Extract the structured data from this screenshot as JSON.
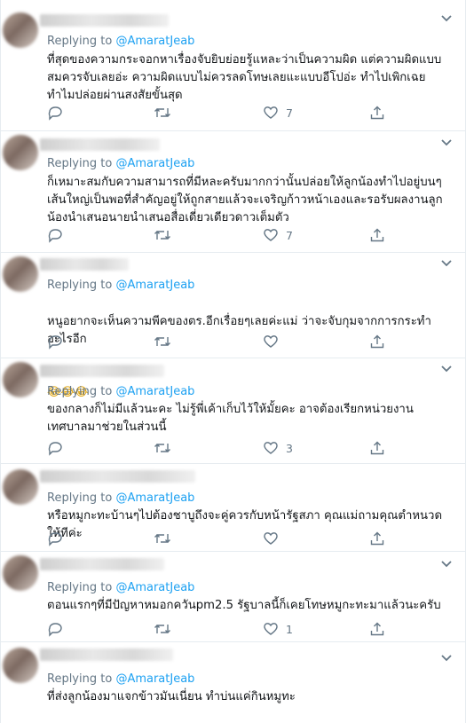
{
  "replying_prefix": "Replying to",
  "colors": {
    "accent": "#1da1f2",
    "muted": "#657786",
    "text": "#14171a",
    "border": "#e6ecf0"
  },
  "icons": {
    "reply": "reply-icon",
    "retweet": "retweet-icon",
    "like": "heart-icon",
    "share": "share-icon",
    "menu": "chevron-down-icon"
  },
  "tweets": [
    {
      "replying_to": "@AmaratJeab",
      "text": "ที่สุดของความกระจอกหาเรื่องจับยิบย่อยรู้แหละว่าเป็นความผิด แต่ความผิดแบบสมควรจับเลยอ่ะ ความผิดแบบไม่ควรลดโทษเลยแะแบบอีโปอ่ะ ทำไปเพิกเฉย ทำไมปล่อยผ่านสงสัยขั้นสุด",
      "replies": "",
      "retweets": "",
      "likes": "7"
    },
    {
      "replying_to": "@AmaratJeab",
      "text": "ก็เหมาะสมกับความสามารถที่มีหละครับมากกว่านั้นปล่อยให้ลูกน้องทำไปอยู่บนๆเส้นใหญ่เป็นพอที่สำคัญอยู่ให้ถูกสายแล้วจะเจริญก้าวหน้าเองและรอรับผลงานลูกน้องนำเสนอนายนำเสนอสื่อเดี่ยวเดียวดาวเต็มตัว",
      "replies": "",
      "retweets": "",
      "likes": "7"
    },
    {
      "replying_to": "@AmaratJeab",
      "text": "หนูอยากจะเห็นความพีคของตร.อีกเรื่อยๆเลยค่ะแม่ ว่าจะจับกุมจากการกระทำอะไรอีก",
      "emoji": "😂😂😂",
      "replies": "",
      "retweets": "",
      "likes": ""
    },
    {
      "replying_to": "@AmaratJeab",
      "text": "ของกลางก็ไม่มีแล้วนะคะ ไม่รู้พี่เค้าเก็บไว้ให้มั้ยคะ อาจต้องเรียกหน่วยงานเทศบาลมาช่วยในส่วนนี้",
      "replies": "",
      "retweets": "",
      "likes": "3"
    },
    {
      "replying_to": "@AmaratJeab",
      "text": "หรือหมูกะทะบ้านๆไปต้องชาบูถึงจะคู่ควรกับหน้ารัฐสภา คุณแม่ถามคุณตำหนวดให้ทีค่ะ",
      "replies": "",
      "retweets": "",
      "likes": ""
    },
    {
      "replying_to": "@AmaratJeab",
      "text": "ตอนแรกๆที่มีปัญหาหมอกควันpm2.5 รัฐบาลนี้ก็เคยโทษหมูกะทะมาแล้วนะครับ",
      "replies": "",
      "retweets": "",
      "likes": "1"
    },
    {
      "replying_to": "@AmaratJeab",
      "text": "ที่ส่งลูกน้องมาแจกข้าวมันเนี่ยน ทำบ่นแค่กินหมูทะ",
      "replies": "",
      "retweets": "",
      "likes": ""
    }
  ]
}
